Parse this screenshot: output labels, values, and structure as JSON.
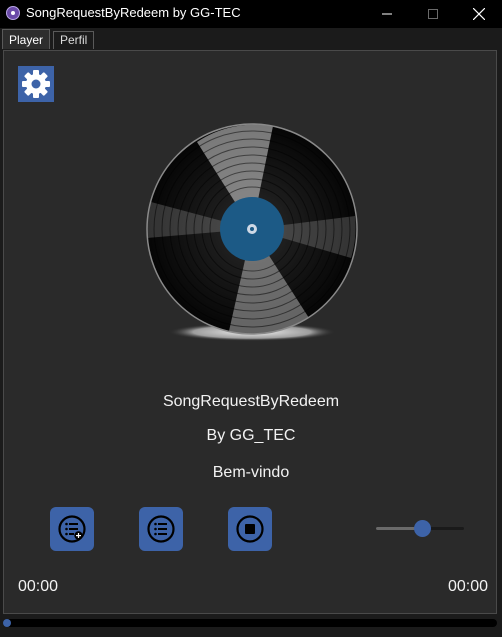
{
  "window": {
    "title": "SongRequestByRedeem by GG-TEC",
    "minimize_icon": "minimize-icon",
    "maximize_icon": "maximize-icon",
    "close_icon": "close-icon"
  },
  "tabs": [
    {
      "label": "Player",
      "active": true
    },
    {
      "label": "Perfil",
      "active": false
    }
  ],
  "player": {
    "settings_icon": "gear-icon",
    "disc_icon": "vinyl-record-icon",
    "app_name": "SongRequestByRedeem",
    "author": "By GG_TEC",
    "status": "Bem-vindo",
    "controls": [
      {
        "icon": "playlist-add-icon"
      },
      {
        "icon": "playlist-icon"
      },
      {
        "icon": "stop-icon"
      }
    ],
    "volume_fraction": 0.5,
    "time_elapsed": "00:00",
    "time_total": "00:00",
    "progress_fraction": 0
  },
  "colors": {
    "accent": "#3d63a8",
    "panel_bg": "#2a2a2a",
    "window_bg": "#1b1b1b",
    "titlebar_bg": "#000000",
    "disc_label": "#1c5a86"
  }
}
